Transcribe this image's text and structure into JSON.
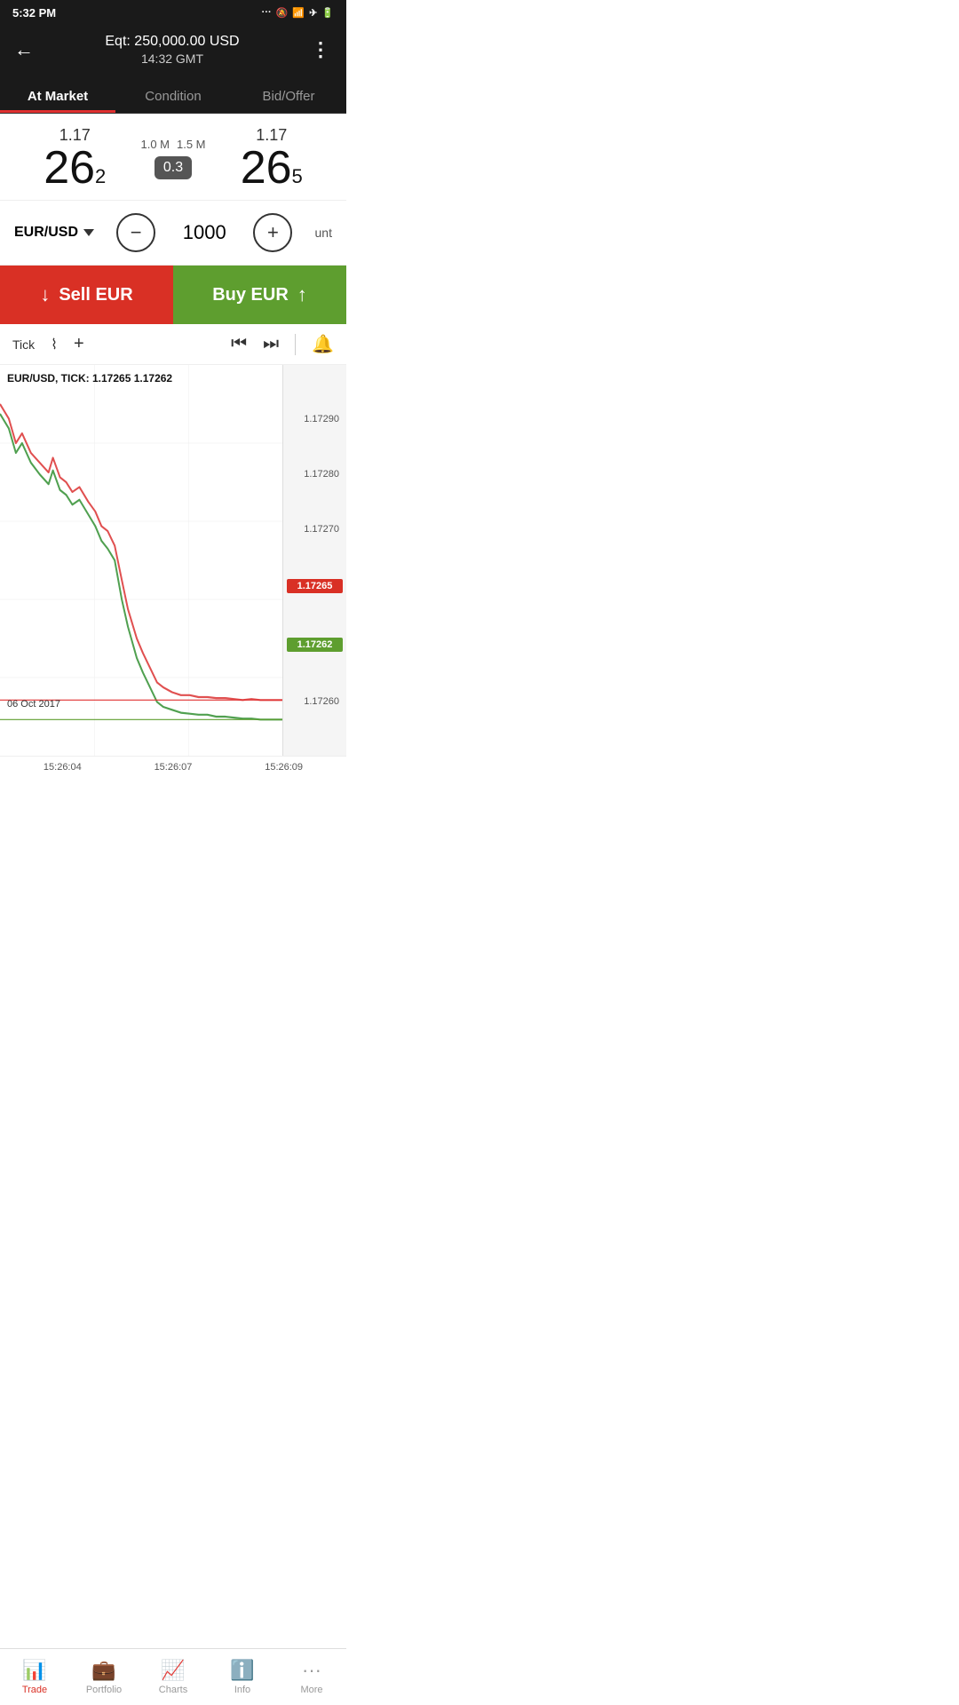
{
  "statusBar": {
    "time": "5:32 PM",
    "icons": "··· 🔕 WiFi ✈ ⚡ 🔋"
  },
  "header": {
    "back": "←",
    "equity_label": "Eqt:",
    "equity_value": "250,000.00 USD",
    "time": "14:32 GMT",
    "menu": "⋮"
  },
  "tabs": [
    {
      "id": "at-market",
      "label": "At Market",
      "active": true
    },
    {
      "id": "condition",
      "label": "Condition",
      "active": false
    },
    {
      "id": "bid-offer",
      "label": "Bid/Offer",
      "active": false
    }
  ],
  "prices": {
    "left": {
      "integer": "1.17",
      "big": "26",
      "sub": "2"
    },
    "spread": {
      "vol_left": "1.0 M",
      "vol_right": "1.5 M",
      "value": "0.3"
    },
    "right": {
      "integer": "1.17",
      "big": "26",
      "sub": "5"
    }
  },
  "controls": {
    "pair": "EUR/USD",
    "quantity": "1000",
    "unit": "unt"
  },
  "buttons": {
    "sell": "Sell EUR",
    "buy": "Buy EUR"
  },
  "toolbar": {
    "tick_label": "Tick",
    "items": [
      "Tick",
      "~",
      "+",
      "|◀",
      "▶|",
      "$"
    ]
  },
  "chart": {
    "title": "EUR/USD, TICK: 1.17265 1.17262",
    "date": "06 Oct 2017",
    "yLabels": [
      "1.17290",
      "1.17280",
      "1.17270",
      "1.17265",
      "1.17262",
      "1.17260"
    ],
    "priceRed": "1.17265",
    "priceGreen": "1.17262",
    "xLabels": [
      "15:26:04",
      "15:26:07",
      "15:26:09"
    ]
  },
  "bottomNav": [
    {
      "id": "trade",
      "label": "Trade",
      "active": true
    },
    {
      "id": "portfolio",
      "label": "Portfolio",
      "active": false
    },
    {
      "id": "charts",
      "label": "Charts",
      "active": false
    },
    {
      "id": "info",
      "label": "Info",
      "active": false
    },
    {
      "id": "more",
      "label": "More",
      "active": false
    }
  ]
}
